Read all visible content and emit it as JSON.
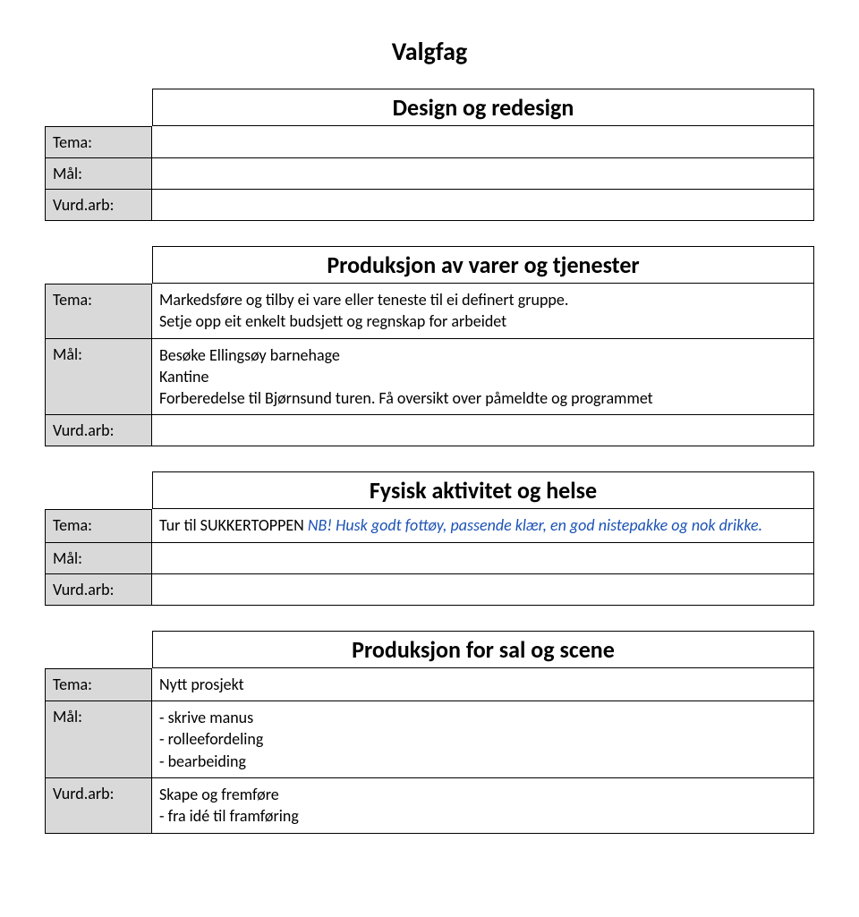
{
  "page_title": "Valgfag",
  "labels": {
    "tema": "Tema:",
    "mal": "Mål:",
    "vurd": "Vurd.arb:"
  },
  "sections": [
    {
      "heading": "Design og redesign",
      "tema": "",
      "mal": "",
      "vurd": ""
    },
    {
      "heading": "Produksjon av varer og tjenester",
      "tema_lines": [
        "Markedsføre og tilby ei vare eller teneste til ei definert gruppe.",
        "Setje opp eit enkelt budsjett og regnskap for arbeidet"
      ],
      "mal_lines": [
        "Besøke Ellingsøy barnehage",
        "Kantine",
        "Forberedelse til Bjørnsund turen. Få oversikt over påmeldte og programmet"
      ],
      "vurd": ""
    },
    {
      "heading": "Fysisk aktivitet og helse",
      "tema_text": "Tur til SUKKERTOPPEN    ",
      "tema_note": "NB! Husk godt fottøy, passende klær, en god nistepakke og nok drikke.",
      "mal": "",
      "vurd": ""
    },
    {
      "heading": "Produksjon for sal og scene",
      "tema": " Nytt prosjekt",
      "mal_lines": [
        "- skrive manus",
        "- rolleefordeling",
        "- bearbeiding"
      ],
      "vurd_lines": [
        "Skape og fremføre",
        "- fra idé til framføring"
      ]
    }
  ]
}
